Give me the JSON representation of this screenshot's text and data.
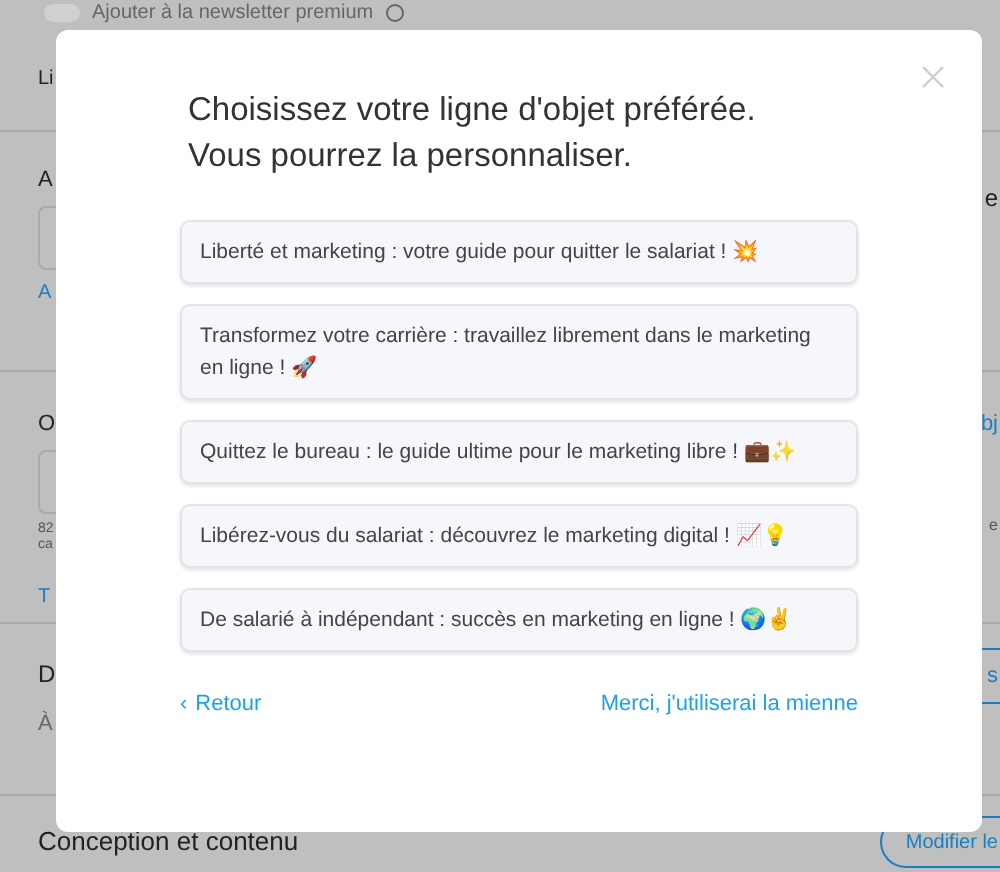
{
  "background": {
    "sections": [
      {
        "left": [
          "Ajouter à la newsletter premium"
        ],
        "toggle": {
          "on": false
        }
      },
      {
        "left": [
          "Li"
        ]
      },
      {
        "left": [
          "A"
        ],
        "link": "A",
        "right": [
          "e"
        ]
      },
      {
        "left": [
          "O"
        ],
        "note": [
          "82",
          "ca"
        ],
        "link": "T",
        "right": [
          "bj",
          "e"
        ]
      },
      {
        "left": [
          "D",
          "À"
        ],
        "right_button": "s"
      },
      {
        "title": "Conception et contenu",
        "right_button": "Modifier le"
      }
    ]
  },
  "modal": {
    "title": [
      "Choisissez votre ligne d'objet préférée.",
      "Vous pourrez la personnaliser."
    ],
    "options": [
      {
        "text": "Liberté et marketing : votre guide pour quitter le salariat ! 💥"
      },
      {
        "text": "Transformez votre carrière : travaillez librement dans le marketing en ligne ! 🚀"
      },
      {
        "text": "Quittez le bureau : le guide ultime pour le marketing libre ! 💼✨"
      },
      {
        "text": "Libérez-vous du salariat : découvrez le marketing digital ! 📈💡"
      },
      {
        "text": "De salarié à indépendant : succès en marketing en ligne ! 🌍✌"
      }
    ],
    "back": "Retour",
    "back_icon": "‹",
    "own": "Merci, j'utiliserai la mienne"
  }
}
